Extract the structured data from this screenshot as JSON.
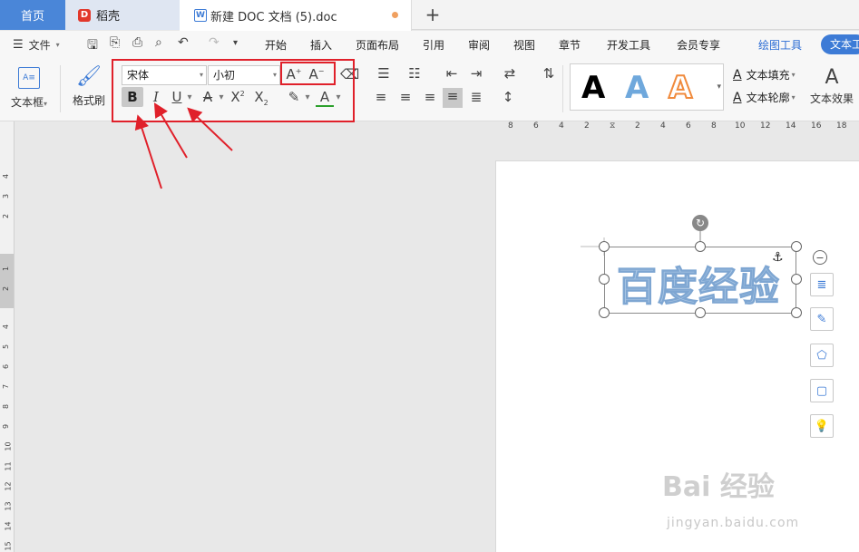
{
  "tabs": {
    "home": "首页",
    "daoke": "稻壳",
    "document": "新建 DOC 文档 (5).doc"
  },
  "menu": {
    "file": "文件",
    "items": [
      "开始",
      "插入",
      "页面布局",
      "引用",
      "审阅",
      "视图",
      "章节",
      "开发工具",
      "会员专享"
    ],
    "drawing_tools": "绘图工具",
    "text_tools": "文本工"
  },
  "ribbon": {
    "textbox_label": "文本框",
    "format_painter_label": "格式刷",
    "font_name": "宋体",
    "font_size": "小初",
    "text_fill": "文本填充",
    "text_outline": "文本轮廓",
    "text_effect": "文本效果"
  },
  "ruler": {
    "h_ticks": [
      "8",
      "6",
      "4",
      "2",
      "2",
      "2",
      "4",
      "6",
      "8",
      "10",
      "12",
      "14",
      "16",
      "18"
    ],
    "v_ticks": [
      "4",
      "3",
      "2",
      "1",
      "1",
      "2",
      "4",
      "5",
      "6",
      "7",
      "8",
      "9",
      "10",
      "11",
      "12",
      "13",
      "14",
      "15"
    ]
  },
  "document": {
    "textbox_content": "百度经验"
  },
  "watermark": {
    "main": "Bai 经验",
    "sub": "jingyan.baidu.com"
  },
  "colors": {
    "accent": "#3d7bd6",
    "highlight_box": "#e0202a",
    "text_fill": "#a9c6e4"
  }
}
